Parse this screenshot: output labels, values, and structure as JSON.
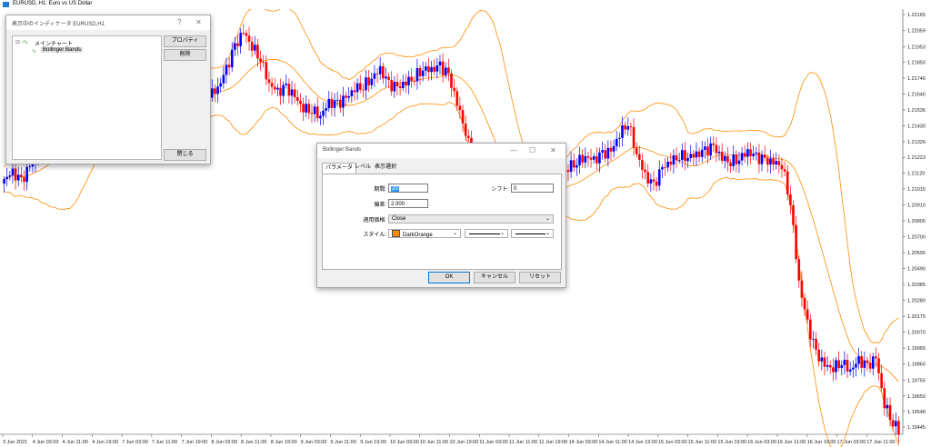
{
  "window": {
    "title": "EURUSD, H1:  Euro vs US Dollar"
  },
  "indicators_window": {
    "title": "表示中のインディケータ EURUSD,H1",
    "help": "?",
    "close": "✕",
    "tree": {
      "root": "メインチャート",
      "child": "Bollinger Bands"
    },
    "buttons": {
      "properties": "プロパティ",
      "delete": "削除",
      "close": "閉じる"
    }
  },
  "bollinger_dialog": {
    "title": "Bollinger Bands",
    "controls": {
      "minimize": "—",
      "maximize": "☐",
      "close": "✕"
    },
    "tabs": [
      "パラメータ",
      "レベル",
      "表示選択"
    ],
    "fields": {
      "period_label": "期間:",
      "period_value": "20",
      "shift_label": "シフト:",
      "shift_value": "0",
      "deviation_label": "偏差:",
      "deviation_value": "2.000",
      "apply_label": "適用価格:",
      "apply_value": "Close",
      "style_label": "スタイル:",
      "color_name": "DarkOrange",
      "color_hex": "#ff8c00"
    },
    "buttons": {
      "ok": "OK",
      "cancel": "キャンセル",
      "reset": "リセット"
    }
  },
  "chart_data": {
    "type": "candlestick",
    "symbol": "EURUSD",
    "timeframe": "H1",
    "indicator": "Bollinger Bands",
    "band_color": "#ff8c00",
    "bull_color": "#0000ff",
    "bear_color": "#ff0000",
    "y_ticks": [
      "1.22165",
      "1.22059",
      "1.21953",
      "1.21850",
      "1.21746",
      "1.21640",
      "1.21536",
      "1.21430",
      "1.21326",
      "1.21223",
      "1.21120",
      "1.21015",
      "1.20910",
      "1.20805",
      "1.20700",
      "1.20595",
      "1.20490",
      "1.20385",
      "1.20280",
      "1.20175",
      "1.20070",
      "1.19965",
      "1.19860",
      "1.19755",
      "1.19650",
      "1.19548",
      "1.19445"
    ],
    "x_ticks": [
      "3 Jun 2021",
      "4 Jun 03:00",
      "4 Jun 11:00",
      "4 Jun 19:00",
      "7 Jun 03:00",
      "7 Jun 11:00",
      "7 Jun 19:00",
      "8 Jun 03:00",
      "8 Jun 11:00",
      "8 Jun 19:00",
      "9 Jun 03:00",
      "9 Jun 11:00",
      "9 Jun 19:00",
      "10 Jun 03:00",
      "10 Jun 11:00",
      "10 Jun 19:00",
      "11 Jun 03:00",
      "11 Jun 11:00",
      "11 Jun 19:00",
      "14 Jun 03:00",
      "14 Jun 11:00",
      "14 Jun 19:00",
      "15 Jun 03:00",
      "15 Jun 11:00",
      "15 Jun 19:00",
      "16 Jun 03:00",
      "16 Jun 11:00",
      "16 Jun 19:00",
      "17 Jun 03:00",
      "17 Jun 11:00"
    ],
    "close_path": [
      1.2108,
      1.2112,
      1.2106,
      1.2116,
      1.2125,
      1.2136,
      1.2142,
      1.2155,
      1.216,
      1.2163,
      1.2165,
      1.2168,
      1.2172,
      1.2166,
      1.217,
      1.2162,
      1.2158,
      1.2165,
      1.2162,
      1.2171,
      1.2168,
      1.2165,
      1.216,
      1.2166,
      1.2164,
      1.2168,
      1.218,
      1.2195,
      1.2205,
      1.2196,
      1.2188,
      1.2171,
      1.2165,
      1.2168,
      1.2162,
      1.2155,
      1.2154,
      1.215,
      1.2158,
      1.2157,
      1.2161,
      1.2168,
      1.217,
      1.2175,
      1.218,
      1.217,
      1.2168,
      1.2172,
      1.2176,
      1.2181,
      1.218,
      1.2182,
      1.2176,
      1.2158,
      1.214,
      1.2115,
      1.2098,
      1.209,
      1.2088,
      1.21,
      1.2106,
      1.2101,
      1.2098,
      1.2094,
      1.2103,
      1.211,
      1.2116,
      1.212,
      1.2123,
      1.212,
      1.2124,
      1.2126,
      1.2138,
      1.2146,
      1.2125,
      1.211,
      1.2103,
      1.2115,
      1.212,
      1.2124,
      1.2123,
      1.2124,
      1.2126,
      1.2129,
      1.2122,
      1.212,
      1.2122,
      1.2126,
      1.2122,
      1.212,
      1.2119,
      1.2118,
      1.2093,
      1.204,
      1.2012,
      1.1993,
      1.1985,
      1.1984,
      1.1988,
      1.1982,
      1.1988,
      1.1984,
      1.199,
      1.196,
      1.1948,
      1.194
    ]
  }
}
